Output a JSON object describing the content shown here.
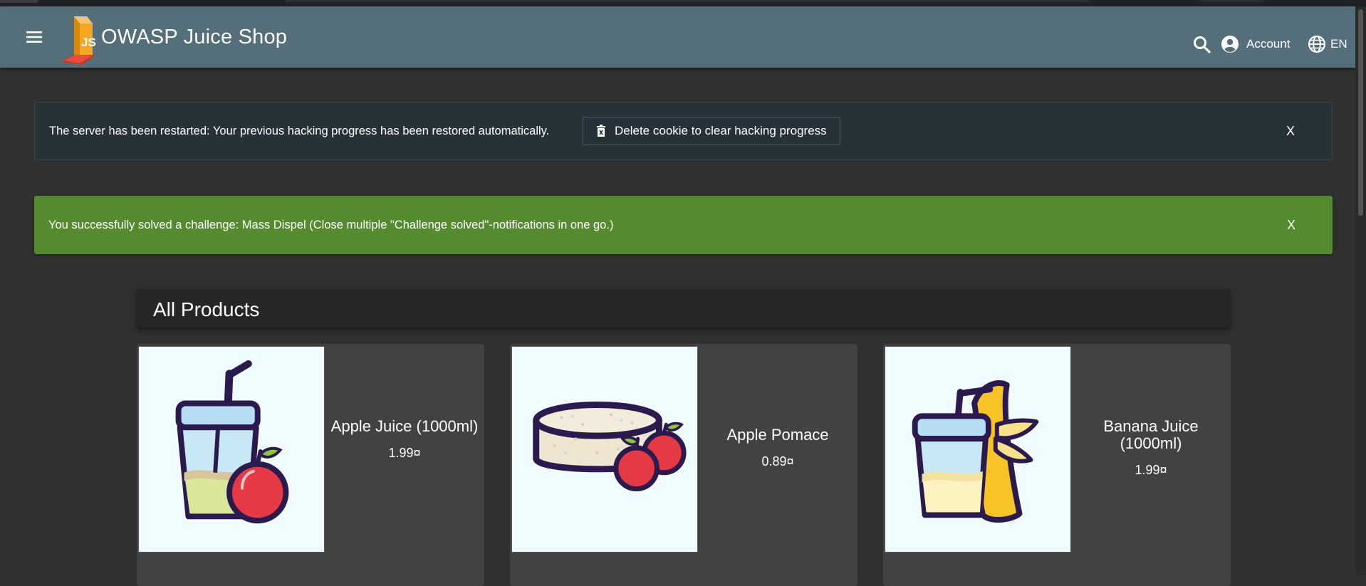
{
  "app": {
    "title": "OWASP Juice Shop"
  },
  "toolbar": {
    "menu_icon": "menu-icon",
    "search_icon": "search-icon",
    "account_label": "Account",
    "account_icon": "account-circle-icon",
    "language_label": "EN",
    "language_icon": "globe-icon"
  },
  "notifications": {
    "restart": {
      "message": "The server has been restarted: Your previous hacking progress has been restored automatically.",
      "button_label": "Delete cookie to clear hacking progress",
      "button_icon": "delete-icon",
      "close_label": "X"
    },
    "challenge": {
      "message": "You successfully solved a challenge: Mass Dispel (Close multiple \"Challenge solved\"-notifications in one go.)",
      "close_label": "X"
    }
  },
  "products": {
    "heading": "All Products",
    "items": [
      {
        "name": "Apple Juice (1000ml)",
        "price": "1.99¤",
        "image_icon": "apple-juice-icon"
      },
      {
        "name": "Apple Pomace",
        "price": "0.89¤",
        "image_icon": "apple-pomace-icon"
      },
      {
        "name": "Banana Juice (1000ml)",
        "price": "1.99¤",
        "image_icon": "banana-juice-icon"
      }
    ]
  },
  "colors": {
    "toolbar": "#546e7a",
    "background": "#303030",
    "restart_banner": "#263238",
    "success_banner": "#558b2f",
    "card": "#424242"
  }
}
